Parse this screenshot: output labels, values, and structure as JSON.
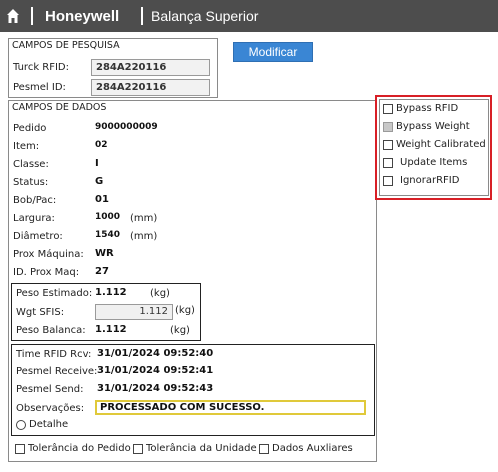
{
  "header": {
    "brand": "Honeywell",
    "title": "Balança Superior",
    "home_icon": "home-icon"
  },
  "pesquisa": {
    "legend": "CAMPOS DE PESQUISA",
    "turck_label": "Turck RFID:",
    "turck_value": "284A220116",
    "pesmel_label": "Pesmel ID:",
    "pesmel_value": "284A220116"
  },
  "actions": {
    "modificar_label": "Modificar"
  },
  "dados": {
    "legend": "CAMPOS DE DADOS",
    "pedido_label": "Pedido",
    "pedido_value": "9000000009",
    "item_label": "Item:",
    "item_value": "02",
    "classe_label": "Classe:",
    "classe_value": "I",
    "status_label": "Status:",
    "status_value": "G",
    "bobpac_label": "Bob/Pac:",
    "bobpac_value": "01",
    "largura_label": "Largura:",
    "largura_value": "1000",
    "largura_unit": "(mm)",
    "diametro_label": "Diâmetro:",
    "diametro_value": "1540",
    "diametro_unit": "(mm)",
    "proxmaq_label": "Prox Máquina:",
    "proxmaq_value": "WR",
    "idprox_label": "ID. Prox Maq:",
    "idprox_value": "27"
  },
  "peso": {
    "estimado_label": "Peso Estimado:",
    "estimado_value": "1.112",
    "estimado_unit": "(kg)",
    "sfis_label": "Wgt SFIS:",
    "sfis_value": "1.112",
    "sfis_unit": "(kg)",
    "balanca_label": "Peso Balanca:",
    "balanca_value": "1.112",
    "balanca_unit": "(kg)"
  },
  "tempos": {
    "rfid_rcv_label": "Time RFID Rcv:",
    "rfid_rcv_value": "31/01/2024 09:52:40",
    "pesmel_receive_label": "Pesmel Receive:",
    "pesmel_receive_value": "31/01/2024 09:52:41",
    "pesmel_send_label": "Pesmel Send:",
    "pesmel_send_value": "31/01/2024 09:52:43",
    "obs_label": "Observações:",
    "obs_value": "PROCESSADO COM SUCESSO.",
    "detalhe_label": "Detalhe"
  },
  "bottom_checks": {
    "tol_pedido": "Tolerância do Pedido",
    "tol_unidade": "Tolerância da Unidade",
    "dados_aux": "Dados Auxliares"
  },
  "options": {
    "bypass_rfid": "Bypass RFID",
    "bypass_weight": "Bypass Weight",
    "weight_calibrated": "Weight Calibrated",
    "update_items": "Update Items",
    "ignorar_rfid": "IgnorarRFID"
  },
  "colors": {
    "header_bg": "#4d4d4d",
    "button_blue": "#3a86d4",
    "highlight_red": "#d81f26",
    "obs_border": "#e0c93a"
  }
}
